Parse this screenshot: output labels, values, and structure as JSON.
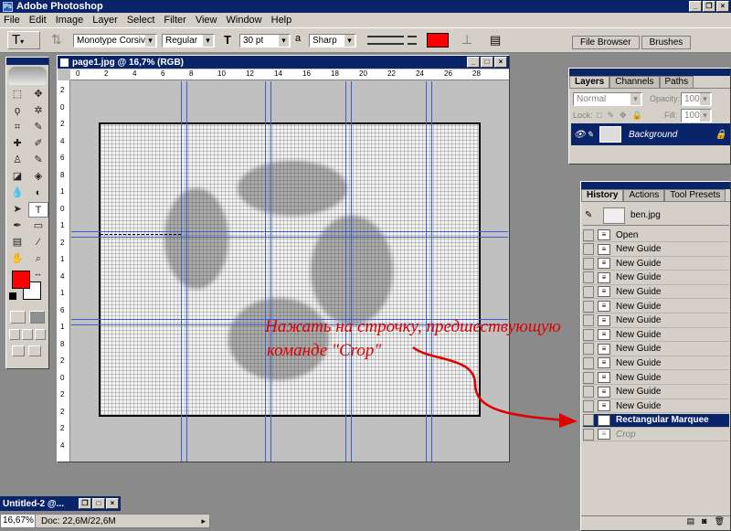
{
  "app": {
    "title": "Adobe Photoshop"
  },
  "menu": [
    "File",
    "Edit",
    "Image",
    "Layer",
    "Select",
    "Filter",
    "View",
    "Window",
    "Help"
  ],
  "options": {
    "font_family": "Monotype Corsiva",
    "font_style": "Regular",
    "font_size": "30 pt",
    "antialias_label": "a",
    "antialias": "Sharp",
    "text_color": "#ff0000",
    "palette_well": [
      "File Browser",
      "Brushes"
    ]
  },
  "document": {
    "title": "page1.jpg @ 16,7% (RGB)",
    "ruler_top": [
      "0",
      "2",
      "4",
      "6",
      "8",
      "10",
      "12",
      "14",
      "16",
      "18",
      "20",
      "22",
      "24",
      "26",
      "28"
    ],
    "ruler_left": [
      "2",
      "0",
      "2",
      "4",
      "6",
      "8",
      "1",
      "0",
      "1",
      "2",
      "1",
      "4",
      "1",
      "6",
      "1",
      "8",
      "2",
      "0",
      "2",
      "2",
      "2",
      "4"
    ]
  },
  "layers": {
    "tabs": [
      "Layers",
      "Channels",
      "Paths"
    ],
    "blend_mode": "Normal",
    "opacity_label": "Opacity:",
    "opacity": "100%",
    "lock_label": "Lock:",
    "fill_label": "Fill:",
    "fill": "100%",
    "layer_name": "Background"
  },
  "history": {
    "tabs": [
      "History",
      "Actions",
      "Tool Presets"
    ],
    "snapshot": "ben.jpg",
    "items": [
      "Open",
      "New Guide",
      "New Guide",
      "New Guide",
      "New Guide",
      "New Guide",
      "New Guide",
      "New Guide",
      "New Guide",
      "New Guide",
      "New Guide",
      "New Guide",
      "New Guide",
      "Rectangular Marquee",
      "Crop"
    ]
  },
  "minimized_window": {
    "title": "Untitled-2 @..."
  },
  "status": {
    "zoom": "16,67%",
    "doc": "Doc: 22,6M/22,6M"
  },
  "annotation": {
    "line1": "Нажать на строчку, предшествующую",
    "line2": "команде \"Crop\"",
    "color": "#e00000"
  }
}
